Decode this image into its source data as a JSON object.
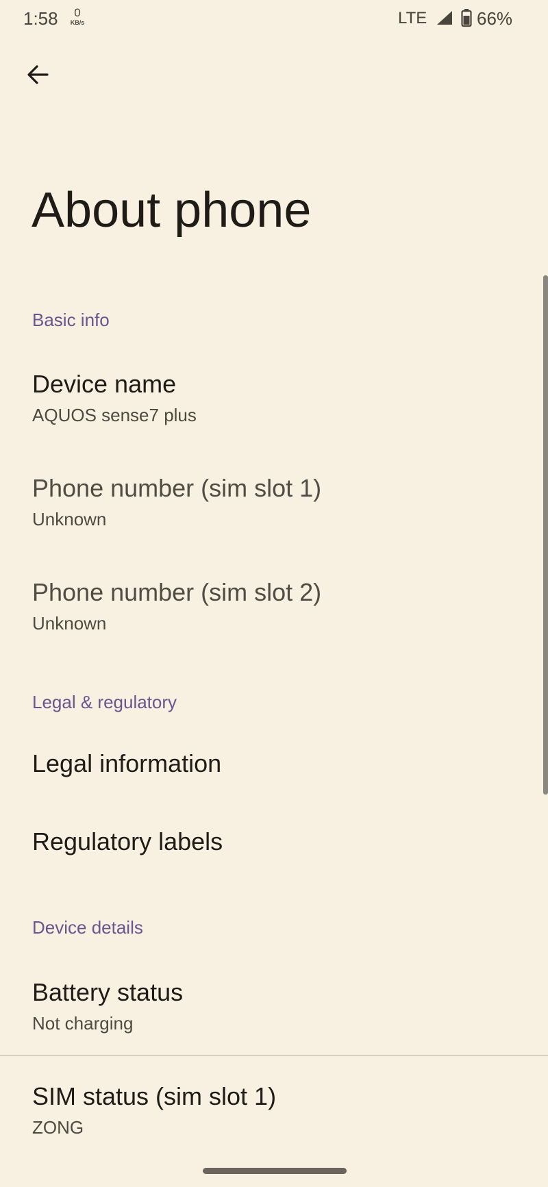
{
  "status_bar": {
    "time": "1:58",
    "net_speed_value": "0",
    "net_speed_unit": "KB/s",
    "network_type": "LTE",
    "battery_percent": "66%",
    "signal_icon": "signal-icon",
    "battery_icon": "battery-icon"
  },
  "header": {
    "back_icon": "arrow-left-icon",
    "title": "About phone"
  },
  "sections": [
    {
      "header": "Basic info",
      "items": [
        {
          "title": "Device name",
          "summary": "AQUOS sense7 plus"
        },
        {
          "title": "Phone number (sim slot 1)",
          "summary": "Unknown"
        },
        {
          "title": "Phone number (sim slot 2)",
          "summary": "Unknown"
        }
      ]
    },
    {
      "header": "Legal & regulatory",
      "items": [
        {
          "title": "Legal information"
        },
        {
          "title": "Regulatory labels"
        }
      ]
    },
    {
      "header": "Device details",
      "items": [
        {
          "title": "Battery status",
          "summary": "Not charging"
        },
        {
          "title": "SIM status (sim slot 1)",
          "summary": "ZONG"
        }
      ]
    }
  ],
  "colors": {
    "background": "#f8f1e2",
    "accent": "#6b558f",
    "text_primary": "#1f1b16",
    "text_secondary": "#4f4a41"
  }
}
